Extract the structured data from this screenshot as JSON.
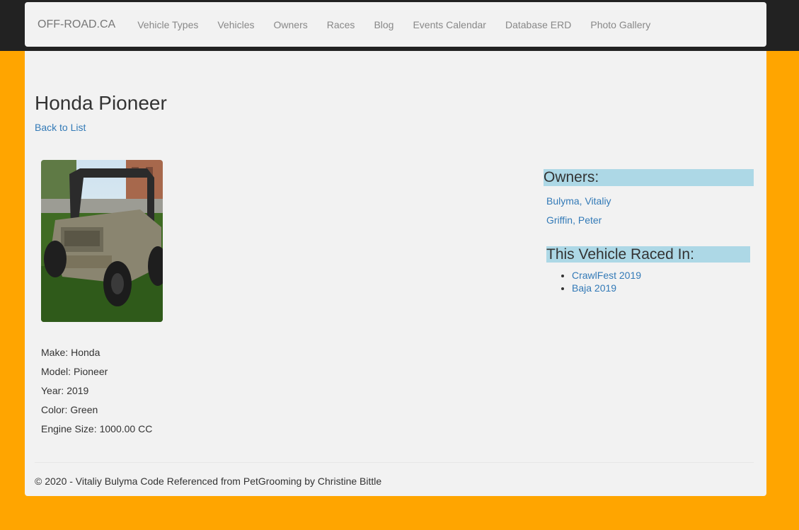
{
  "navbar": {
    "brand": "OFF-ROAD.CA",
    "links": [
      "Vehicle Types",
      "Vehicles",
      "Owners",
      "Races",
      "Blog",
      "Events Calendar",
      "Database ERD",
      "Photo Gallery"
    ]
  },
  "page": {
    "title": "Honda Pioneer",
    "back_link": "Back to List"
  },
  "details": [
    {
      "label": "Make:",
      "value": "Honda"
    },
    {
      "label": "Model:",
      "value": "Pioneer"
    },
    {
      "label": "Year:",
      "value": "2019"
    },
    {
      "label": "Color:",
      "value": "Green"
    },
    {
      "label": "Engine Size:",
      "value": "1000.00 CC"
    }
  ],
  "owners": {
    "heading": "Owners:",
    "list": [
      "Bulyma, Vitaliy",
      "Griffin, Peter"
    ]
  },
  "races": {
    "heading": "This Vehicle Raced In:",
    "list": [
      "CrawlFest 2019",
      "Baja 2019"
    ]
  },
  "colors": {
    "page_background": "#ffa500",
    "topbar": "#222222",
    "panel": "#f2f2f2",
    "heading_highlight": "#add8e6",
    "link": "#337ab7"
  },
  "footer": "© 2020 - Vitaliy Bulyma Code Referenced from PetGrooming by Christine Bittle"
}
